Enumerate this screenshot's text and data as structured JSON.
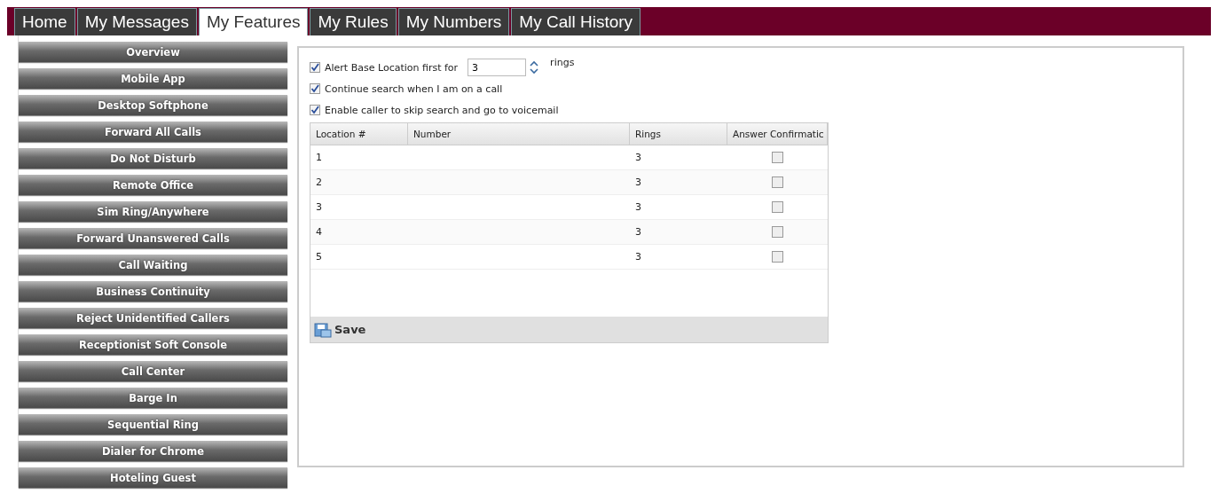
{
  "tabs": [
    {
      "label": "Home",
      "selected": false
    },
    {
      "label": "My Messages",
      "selected": false
    },
    {
      "label": "My Features",
      "selected": true
    },
    {
      "label": "My Rules",
      "selected": false
    },
    {
      "label": "My Numbers",
      "selected": false
    },
    {
      "label": "My Call History",
      "selected": false
    }
  ],
  "sidebar": {
    "items": [
      "Overview",
      "Mobile App",
      "Desktop Softphone",
      "Forward All Calls",
      "Do Not Disturb",
      "Remote Office",
      "Sim Ring/Anywhere",
      "Forward Unanswered Calls",
      "Call Waiting",
      "Business Continuity",
      "Reject Unidentified Callers",
      "Receptionist Soft Console",
      "Call Center",
      "Barge In",
      "Sequential Ring",
      "Dialer for Chrome",
      "Hoteling Guest"
    ]
  },
  "options": [
    {
      "label": "Alert Base Location first for",
      "checked": true,
      "rings_field": {
        "value": "3"
      },
      "suffix": "rings"
    },
    {
      "label": "Continue search when I am on a call",
      "checked": true
    },
    {
      "label": "Enable caller to skip search and go to voicemail",
      "checked": true
    }
  ],
  "table": {
    "columns": [
      "Location #",
      "Number",
      "Rings",
      "Answer Confirmatic"
    ],
    "rows": [
      {
        "location": "1",
        "rings": "3",
        "confirm": false
      },
      {
        "location": "2",
        "rings": "3",
        "confirm": false
      },
      {
        "location": "3",
        "rings": "3",
        "confirm": false
      },
      {
        "location": "4",
        "rings": "3",
        "confirm": false
      },
      {
        "location": "5",
        "rings": "3",
        "confirm": false
      }
    ],
    "save_button": "Save"
  }
}
